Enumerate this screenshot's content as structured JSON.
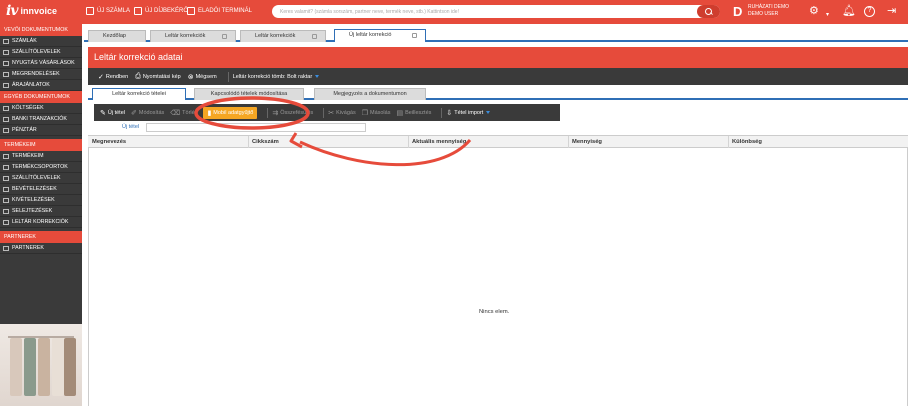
{
  "app": {
    "logo_text": "innvoice",
    "logo_mark": "iv"
  },
  "topbar": {
    "actions": [
      "ÚJ SZÁMLA",
      "ÚJ DÍJBEKÉRŐ",
      "ELADÓI TERMINÁL"
    ],
    "search_placeholder": "Keres valamit? (számla sorszám, partner neve, termék neve, stb.) Kattintson ide!",
    "avatar_letter": "D",
    "user_line1": "RUHÁZATI DEMO",
    "user_line2": "DEMO USER"
  },
  "sidebar": {
    "sections": [
      {
        "title": "VEVŐI DOKUMENTUMOK",
        "items": [
          "SZÁMLÁK",
          "SZÁLLÍTÓLEVELEK",
          "NYUGTÁS VÁSÁRLÁSOK",
          "MEGRENDELÉSEK",
          "ÁRAJÁNLATOK"
        ]
      },
      {
        "title": "EGYÉB DOKUMENTUMOK",
        "items": [
          "KÖLTSÉGEK",
          "BANKI TRANZAKCIÓK",
          "PÉNZTÁR"
        ]
      },
      {
        "title": "TERMÉKEIM",
        "items": [
          "TERMÉKEIM",
          "TERMÉKCSOPORTOK",
          "SZÁLLÍTÓLEVELEK",
          "BEVÉTELEZÉSEK",
          "KIVÉTELEZÉSEK",
          "SELEJTEZÉSEK",
          "LELTÁR KORREKCIÓK"
        ]
      },
      {
        "title": "PARTNEREK",
        "items": [
          "PARTNEREK"
        ]
      }
    ]
  },
  "window_tabs": [
    "Kezdőlap",
    "Leltár korrekciók",
    "Leltár korrekciók",
    "Új leltár korrekció"
  ],
  "panel": {
    "title": "Leltár korrekció adatai",
    "actions": [
      "Rendben",
      "Nyomtatási kép",
      "Mégsem"
    ],
    "block_label": "Leltár korrekció tömb: Bolt raktar"
  },
  "inner_tabs": [
    "Leltár korrekció tételei",
    "Kapcsolódó tételek módosítása",
    "Megjegyzés a dokumentumon"
  ],
  "table_toolbar": [
    "Új tétel",
    "Módosítás",
    "Törlés",
    "Mobil adatgyűjtő",
    "Összefésülés",
    "Kivágás",
    "Másolás",
    "Beillesztés",
    "Tétel import"
  ],
  "new_item": {
    "label": "Új tétel",
    "value": ""
  },
  "grid": {
    "columns": [
      "Megnevezés",
      "Cikkszám",
      "Aktuális mennyiség",
      "Mennyiség",
      "Különbség"
    ],
    "empty_text": "Nincs elem."
  },
  "colors": {
    "brand_red": "#e64b3b",
    "dark": "#3a3a3a",
    "blue": "#2f6fb6",
    "highlight": "#f5a623"
  }
}
